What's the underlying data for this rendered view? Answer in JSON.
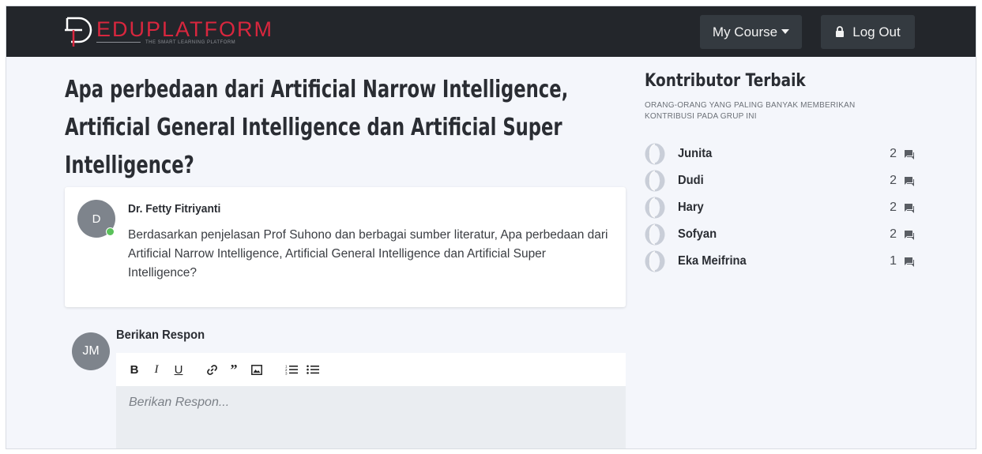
{
  "brand": {
    "name": "EDUPLATFORM",
    "tagline": "THE SMART LEARNING PLATFORM",
    "color": "#d9263e"
  },
  "nav": {
    "course_label": "My Course",
    "logout_label": "Log Out"
  },
  "question": {
    "title": "Apa perbedaan dari Artificial Narrow Intelligence, Artificial General Intelligence dan Artificial Super Intelligence?",
    "author_initial": "D",
    "author": "Dr. Fetty Fitriyanti",
    "body": "Berdasarkan penjelasan Prof Suhono dan berbagai sumber literatur, Apa perbedaan dari Artificial Narrow Intelligence, Artificial General Intelligence dan Artificial Super Intelligence?"
  },
  "respond": {
    "avatar_initials": "JM",
    "label": "Berikan Respon",
    "placeholder": "Berikan Respon...",
    "toolbar": [
      "bold-icon",
      "italic-icon",
      "underline-icon",
      "link-icon",
      "quote-icon",
      "image-icon",
      "ordered-list-icon",
      "bullet-list-icon"
    ]
  },
  "sidebar": {
    "title": "Kontributor Terbaik",
    "subtitle": "ORANG-ORANG YANG PALING BANYAK MEMBERIKAN KONTRIBUSI PADA GRUP INI",
    "contributors": [
      {
        "name": "Junita",
        "count": "2"
      },
      {
        "name": "Dudi",
        "count": "2"
      },
      {
        "name": "Hary",
        "count": "2"
      },
      {
        "name": "Sofyan",
        "count": "2"
      },
      {
        "name": "Eka Meifrina",
        "count": "1"
      }
    ]
  }
}
